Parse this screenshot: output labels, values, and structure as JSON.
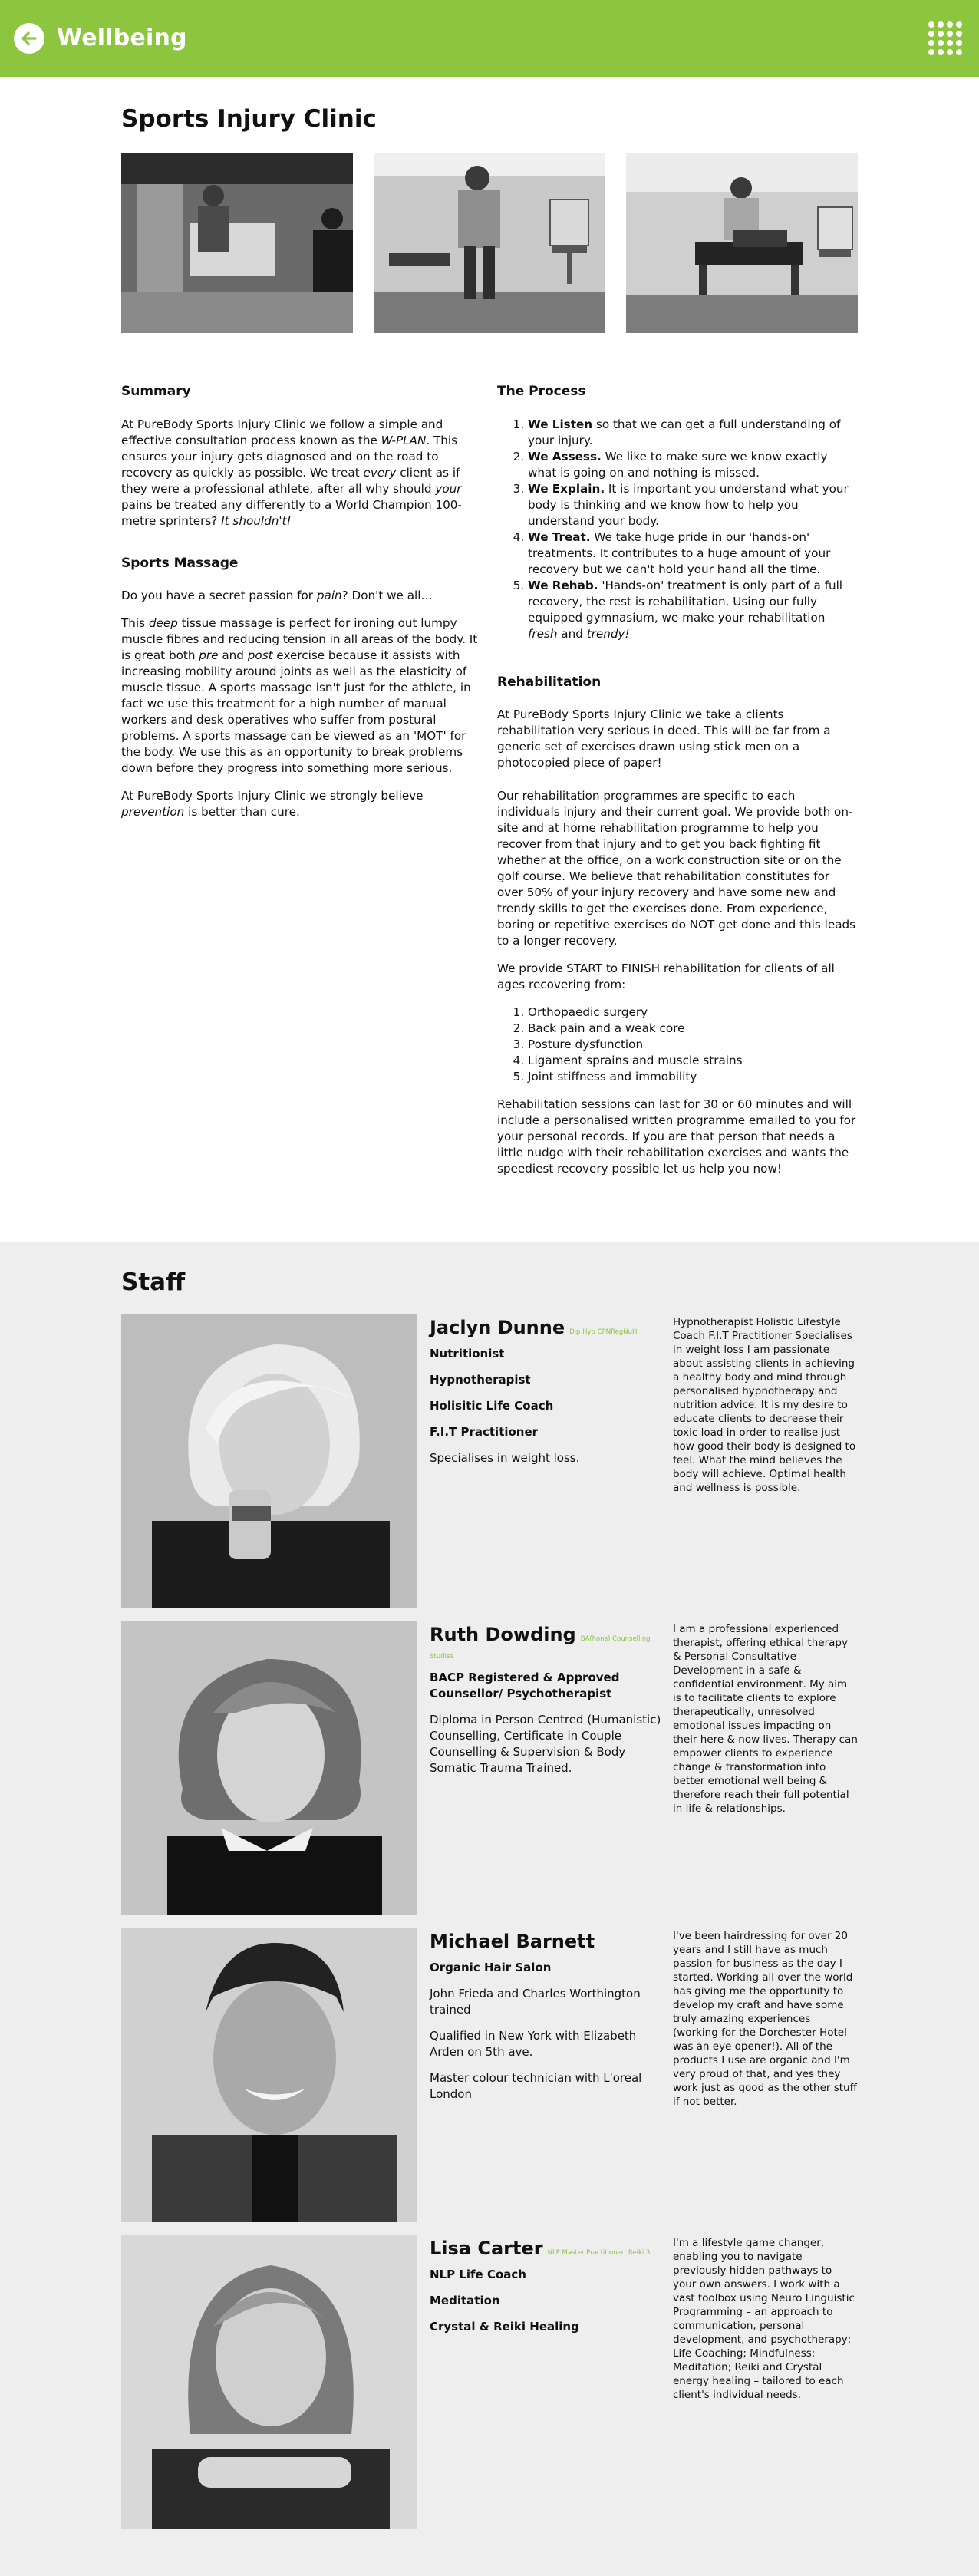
{
  "header": {
    "title": "Wellbeing",
    "back_icon": "arrow-left-icon",
    "menu_icon": "grid-dots-icon",
    "accent": "#8cc63f"
  },
  "page": {
    "title": "Sports Injury Clinic"
  },
  "summary": {
    "heading": "Summary",
    "p1_a": "At PureBody Sports Injury Clinic we follow a simple and effective consultation process known as the ",
    "p1_em": "W-PLAN",
    "p1_b": ". This ensures your injury gets diagnosed and on the road to recovery as quickly as possible. We treat ",
    "p1_em2": "every",
    "p1_c": " client as if they were a professional athlete, after all why should ",
    "p1_em3": "your",
    "p1_d": " pains be treated any differently to a World Champion 100-metre sprinters? ",
    "p1_em4": "It shouldn't!"
  },
  "massage": {
    "heading": "Sports Massage",
    "p1_a": "Do you have a secret passion for ",
    "p1_em": "pain",
    "p1_b": "? Don't we all…",
    "p2_a": "This ",
    "p2_em": "deep",
    "p2_b": " tissue massage is perfect for ironing out lumpy muscle fibres and reducing tension in all areas of the body. It is great both ",
    "p2_em2": "pre",
    "p2_c": " and ",
    "p2_em3": "post",
    "p2_d": " exercise because it assists with increasing mobility around joints as well as the elasticity of muscle tissue. A sports massage isn't just for the athlete, in fact we use this treatment for a high number of manual workers and desk operatives who suffer from postural problems. A sports massage can be viewed as an 'MOT' for the body. We use this as an opportunity to break problems down before they progress into something more serious.",
    "p3_a": "At PureBody Sports Injury Clinic we strongly believe ",
    "p3_em": "prevention",
    "p3_b": " is better than cure."
  },
  "process": {
    "heading": "The Process",
    "steps": [
      {
        "bold": "We Listen",
        "text": " so that we can get a full understanding of your injury."
      },
      {
        "bold": "We Assess.",
        "text": " We like to make sure we know exactly what is going on and nothing is missed."
      },
      {
        "bold": "We Explain.",
        "text": " It is important you understand what your body is thinking and we know how to help you understand your body."
      },
      {
        "bold": "We Treat.",
        "text": " We take huge pride in our 'hands-on' treatments. It contributes to a huge amount of your recovery but we can't hold your hand all the time."
      },
      {
        "bold": "We Rehab.",
        "text": " 'Hands-on' treatment is only part of a full recovery, the rest is rehabilitation. Using our fully equipped gymnasium, we make your rehabilitation ",
        "em1": "fresh",
        "mid": " and ",
        "em2": "trendy!"
      }
    ]
  },
  "rehab": {
    "heading": "Rehabilitation",
    "p1": "At PureBody Sports Injury Clinic we take a clients rehabilitation very serious in deed. This will be far from a generic set of exercises drawn using stick men on a photocopied piece of paper!",
    "p2": "Our rehabilitation programmes are specific to each individuals injury and their current goal. We provide both on-site and at home rehabilitation programme to help you recover from that injury and to get you back fighting fit whether at the office, on a work construction site or on the golf course. We believe that rehabilitation constitutes for over 50% of your injury recovery and have some new and trendy skills to get the exercises done. From experience, boring or repetitive exercises do NOT get done and this leads to a longer recovery.",
    "p3": "We provide START to FINISH rehabilitation for clients of all ages recovering from:",
    "conditions": [
      "Orthopaedic surgery",
      "Back pain and a weak core",
      "Posture dysfunction",
      "Ligament sprains and muscle strains",
      "Joint stiffness and immobility"
    ],
    "p4": "Rehabilitation sessions can last for 30 or 60 minutes and will include a personalised written programme emailed to you for your personal records. If you are that person that needs a little nudge with their rehabilitation exercises and wants the speediest recovery possible let us help you now!"
  },
  "staff": {
    "heading": "Staff",
    "members": [
      {
        "name": "Jaclyn Dunne",
        "quals": "Dip Hyp CPNRegNuH",
        "roles": [
          "Nutritionist",
          "Hypnotherapist",
          "Holisitic Life Coach",
          "F.I.T Practitioner"
        ],
        "details": [
          "Specialises in weight loss."
        ],
        "bio": "Hypnotherapist Holistic Lifestyle Coach F.I.T Practitioner Specialises in weight loss I am passionate about assisting clients in achieving a healthy body and mind through personalised hypnotherapy and nutrition advice. It is my desire to educate clients to decrease their toxic load in order to realise just how good their body is designed to feel. What the mind believes the body will achieve. Optimal health and wellness is possible."
      },
      {
        "name": "Ruth Dowding",
        "quals": "BA(hons) Counselling Studies",
        "roles": [
          "BACP Registered & Approved Counsellor/ Psychotherapist"
        ],
        "details": [
          "Diploma in Person Centred (Humanistic) Counselling, Certificate in Couple Counselling & Supervision & Body Somatic Trauma Trained."
        ],
        "bio": "I am a professional experienced therapist, offering ethical therapy & Personal Consultative Development in a safe & confidential environment. My aim is to facilitate clients to explore therapeutically, unresolved emotional issues impacting on their here & now lives. Therapy can empower clients to experience change & transformation into better emotional well being & therefore reach their full potential in life & relationships."
      },
      {
        "name": "Michael Barnett",
        "quals": "",
        "roles": [
          "Organic Hair Salon"
        ],
        "details": [
          "John Frieda and Charles Worthington trained",
          "Qualified in New York with Elizabeth Arden on 5th ave.",
          "Master colour technician with L'oreal London"
        ],
        "bio": "I've been hairdressing for over 20 years and I still have as much passion for business as the day I started. Working all over the world has giving me the opportunity to develop my craft and have some truly amazing experiences (working for the Dorchester Hotel was an eye opener!). All of the products I use are organic and I'm very proud of that, and yes they work just as good as the other stuff if not better."
      },
      {
        "name": "Lisa Carter",
        "quals": "NLP Master Practitioner; Reiki 3",
        "roles": [
          "NLP Life Coach",
          "Meditation",
          "Crystal & Reiki Healing"
        ],
        "details": [],
        "bio": "I'm a lifestyle game changer, enabling you to navigate previously hidden pathways to your own answers. I work with a vast toolbox using Neuro Linguistic Programming – an approach to communication, personal development, and psychotherapy; Life Coaching; Mindfulness; Meditation; Reiki and Crystal energy healing – tailored to each client's individual needs."
      }
    ]
  }
}
